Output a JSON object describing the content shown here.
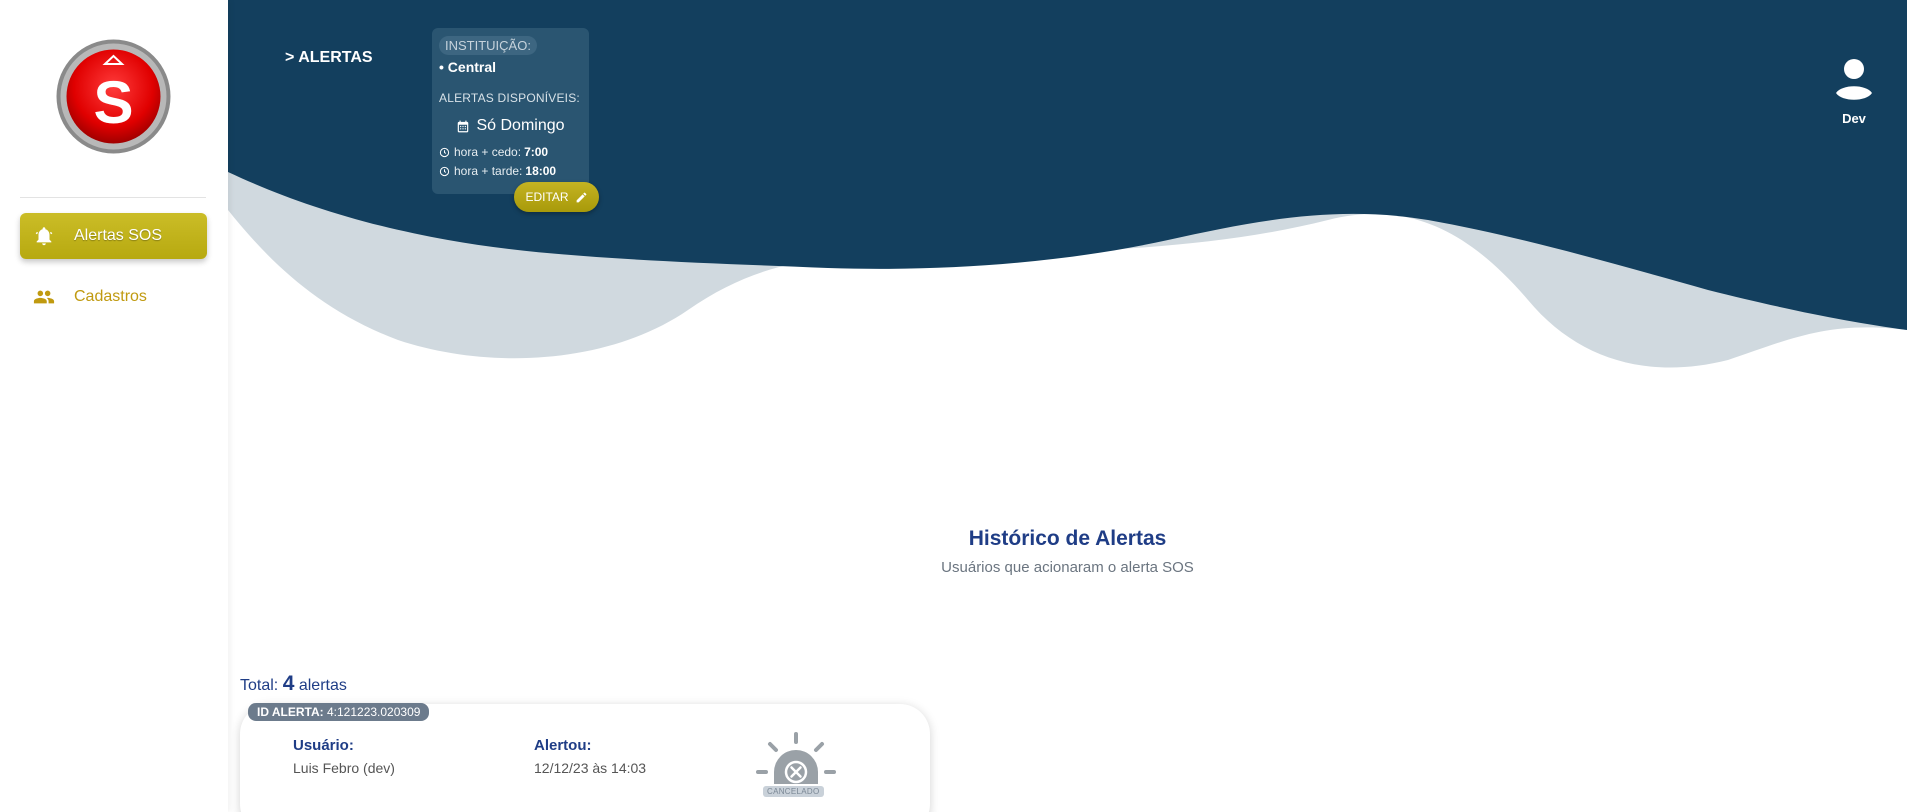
{
  "sidebar": {
    "items": [
      {
        "label": "Alertas SOS",
        "icon": "bell-ring-icon"
      },
      {
        "label": "Cadastros",
        "icon": "people-icon"
      }
    ]
  },
  "header": {
    "breadcrumb": "> ALERTAS",
    "institution": {
      "badge": "INSTITUIÇÃO:",
      "name": "• Central",
      "alerts_label": "ALERTAS DISPONÍVEIS:",
      "day": "Só Domingo",
      "early_label": "hora + cedo:",
      "early_value": "7:00",
      "late_label": "hora + tarde:",
      "late_value": "18:00",
      "edit_label": "EDITAR"
    },
    "user": {
      "name": "Dev"
    }
  },
  "main": {
    "title": "Histórico de Alertas",
    "subtitle": "Usuários que acionaram o alerta SOS",
    "total_prefix": "Total:",
    "total_count": "4",
    "total_suffix": "alertas",
    "alerts": [
      {
        "id_label": "ID ALERTA:",
        "id_value": "4:121223.020309",
        "user_label": "Usuário:",
        "user_value": "Luis Febro (dev)",
        "alerted_label": "Alertou:",
        "alerted_value": "12/12/23 às 14:03",
        "status": "CANCELADO"
      }
    ]
  },
  "colors": {
    "header_dark": "#133f5e",
    "wave_light": "#d0d9df",
    "accent_gold": "#c0b01c",
    "title_blue": "#1f3d86"
  }
}
